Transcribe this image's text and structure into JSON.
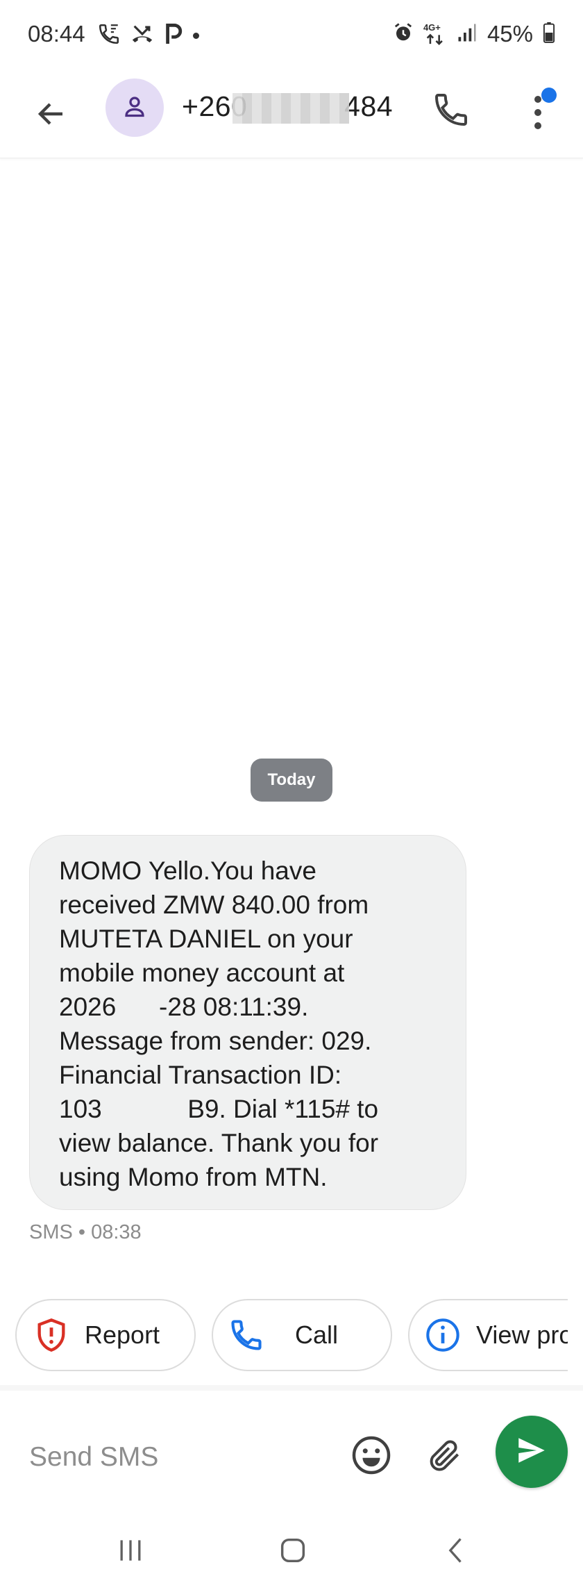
{
  "status_bar": {
    "time": "08:44",
    "battery_percent": "45%",
    "network_label": "4G+",
    "left_icons": [
      "wifi-calling-icon",
      "missed-call-icon",
      "parking-icon"
    ],
    "right_icons": [
      "alarm-icon",
      "network-4g-icon",
      "signal-icon",
      "battery-icon"
    ]
  },
  "header": {
    "contact_name": "+260      484",
    "icons": {
      "back": "arrow-back-icon",
      "avatar": "person-icon",
      "call": "phone-icon",
      "more": "more-vert-icon"
    },
    "notification_dot_color": "#1a73e8"
  },
  "conversation": {
    "date_chip": "Today",
    "message": {
      "text": "MOMO Yello.You have\nreceived ZMW 840.00 from\nMUTETA DANIEL on your\nmobile money account at\n2026   -28 08:11:39.\nMessage from sender: 029.\nFinancial Transaction ID:\n103      B9. Dial *115# to\nview balance. Thank you for\nusing Momo from MTN.",
      "meta": "SMS • 08:38"
    }
  },
  "suggestions": [
    {
      "label": "Report",
      "icon": "shield-alert-icon",
      "icon_color": "#d93025"
    },
    {
      "label": "Call",
      "icon": "phone-icon",
      "icon_color": "#1a73e8"
    },
    {
      "label": "View pro",
      "icon": "info-icon",
      "icon_color": "#1a73e8"
    }
  ],
  "compose": {
    "placeholder": "Send SMS",
    "value": "",
    "icons": {
      "emoji": "emoji-icon",
      "attach": "paperclip-icon",
      "send": "send-icon"
    },
    "send_color": "#1e8e4a"
  },
  "nav_bar": {
    "icons": [
      "recents-icon",
      "home-icon",
      "back-icon"
    ]
  }
}
